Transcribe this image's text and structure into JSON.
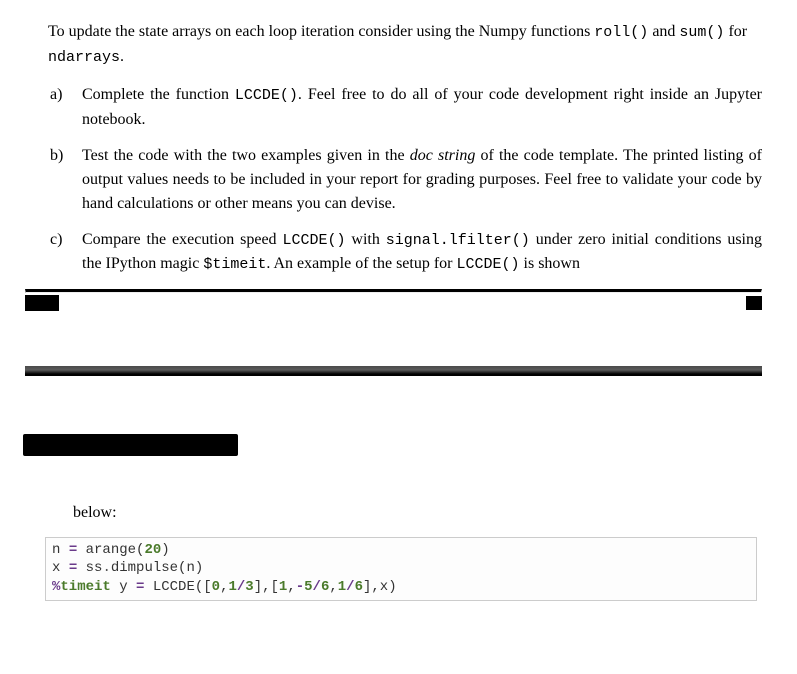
{
  "intro": {
    "prefix": "To update the state arrays on each loop iteration consider using the Numpy functions ",
    "code1": "roll()",
    "mid": " and ",
    "code2": "sum()",
    "mid2": " for ",
    "code3": "ndarrays",
    "suffix": "."
  },
  "items": {
    "a": {
      "marker": "a)",
      "t1": "Complete the function ",
      "code1": "LCCDE()",
      "t2": ". Feel free to do all of your code development right inside an Jupyter notebook."
    },
    "b": {
      "marker": "b)",
      "t1": "Test the code with the two examples given in the ",
      "italic": "doc string",
      "t2": " of the code template. The printed listing of output values needs to be included in your report for grading purposes. Feel free to validate your code by hand calculations or other means you can devise."
    },
    "c": {
      "marker": "c)",
      "t1": "Compare the execution speed ",
      "code1": "LCCDE()",
      "t2": " with ",
      "code2": "signal.lfilter()",
      "t3": " under zero initial conditions using the IPython magic ",
      "code3": "$timeit",
      "t4": ". An example of the setup for ",
      "code4": "LCCDE()",
      "t5": " is shown"
    }
  },
  "below_label": "below:",
  "code": {
    "l1a": "n ",
    "l1op": "=",
    "l1b": " arange(",
    "l1num": "20",
    "l1c": ")",
    "l2a": "x ",
    "l2op": "=",
    "l2b": " ss",
    "l2dot": ".",
    "l2c": "dimpulse(n)",
    "l3a": "%",
    "l3b": "timeit",
    "l3c": " y ",
    "l3op": "=",
    "l3d": " LCCDE([",
    "l3n1": "0",
    "l3e": ",",
    "l3n2": "1",
    "l3f": "/",
    "l3n3": "3",
    "l3g": "],[",
    "l3n4": "1",
    "l3h": ",",
    "l3n5": "-",
    "l3n5b": "5",
    "l3i": "/",
    "l3n6": "6",
    "l3j": ",",
    "l3n7": "1",
    "l3k": "/",
    "l3n8": "6",
    "l3l": "],x)"
  }
}
